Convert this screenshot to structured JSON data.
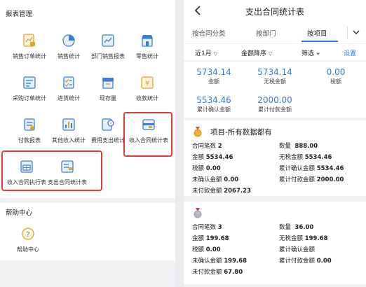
{
  "left": {
    "section1_title": "报表管理",
    "items": [
      {
        "label": "销售订单统计",
        "icon": "sales-order-icon"
      },
      {
        "label": "销售统计",
        "icon": "pie-chart-icon"
      },
      {
        "label": "部门销售报表",
        "icon": "department-report-icon"
      },
      {
        "label": "零售统计",
        "icon": "retail-shop-icon"
      },
      {
        "label": "采购订单统计",
        "icon": "purchase-order-icon"
      },
      {
        "label": "进货统计",
        "icon": "checklist-icon"
      },
      {
        "label": "现存量",
        "icon": "inventory-icon"
      },
      {
        "label": "收款统计",
        "icon": "yen-receipt-icon"
      },
      {
        "label": "付款报表",
        "icon": "payment-icon"
      },
      {
        "label": "其他收入统计",
        "icon": "bar-chart-icon"
      },
      {
        "label": "费用支出统计",
        "icon": "expense-icon"
      },
      {
        "label": "收入合同统计表",
        "icon": "income-contract-icon"
      },
      {
        "label": "收入合同执行表",
        "icon": "contract-execution-icon"
      },
      {
        "label": "支出合同统计表",
        "icon": "expense-contract-icon"
      }
    ],
    "section2_title": "帮助中心",
    "help_label": "帮助中心"
  },
  "right": {
    "title": "支出合同统计表",
    "tabs": [
      "按合同分类",
      "按部门",
      "按项目"
    ],
    "filters": {
      "period": "近1月",
      "sort": "金额降序",
      "filter": "筛选",
      "settings": "设置"
    },
    "summary": [
      {
        "value": "5734.14",
        "label": "金额"
      },
      {
        "value": "5734.14",
        "label": "无税金额"
      },
      {
        "value": "0.00",
        "label": "税额"
      },
      {
        "value": "5534.46",
        "label": "累计确认金额"
      },
      {
        "value": "2000.00",
        "label": "累计付款金额"
      }
    ],
    "projects": [
      {
        "title": "项目-所有数据都有",
        "rows": [
          [
            {
              "k": "合同笔数",
              "v": "2"
            },
            {
              "k": "数量",
              "v": "888.00"
            }
          ],
          [
            {
              "k": "金额",
              "v": "5534.46"
            },
            {
              "k": "无税金额",
              "v": "5534.46"
            }
          ],
          [
            {
              "k": "税额",
              "v": "0.00"
            },
            {
              "k": "累计确认金额",
              "v": "5534.46"
            }
          ],
          [
            {
              "k": "未确认金额",
              "v": "0.00"
            },
            {
              "k": "累计付款金额",
              "v": "2000.00"
            }
          ],
          [
            {
              "k": "未付款金额",
              "v": "2067.23"
            }
          ]
        ]
      },
      {
        "title": "",
        "rows": [
          [
            {
              "k": "合同笔数",
              "v": "3"
            },
            {
              "k": "数量",
              "v": "36.00"
            }
          ],
          [
            {
              "k": "金额",
              "v": "199.68"
            },
            {
              "k": "无税金额",
              "v": "199.68"
            }
          ],
          [
            {
              "k": "税额",
              "v": "0.00"
            },
            {
              "k": "累计确认金额",
              "v": ""
            }
          ],
          [
            {
              "k": "未确认金额",
              "v": "199.68"
            },
            {
              "k": "累计付款金额",
              "v": "0.00"
            }
          ],
          [
            {
              "k": "未付款金额",
              "v": "67.80"
            }
          ]
        ]
      }
    ]
  },
  "colors": {
    "accent": "#1f7cf2",
    "value_blue": "#2f7bd3",
    "highlight_red": "#e53935",
    "medal_gold": "#f0b323",
    "medal_silver": "#b8bcc4"
  }
}
